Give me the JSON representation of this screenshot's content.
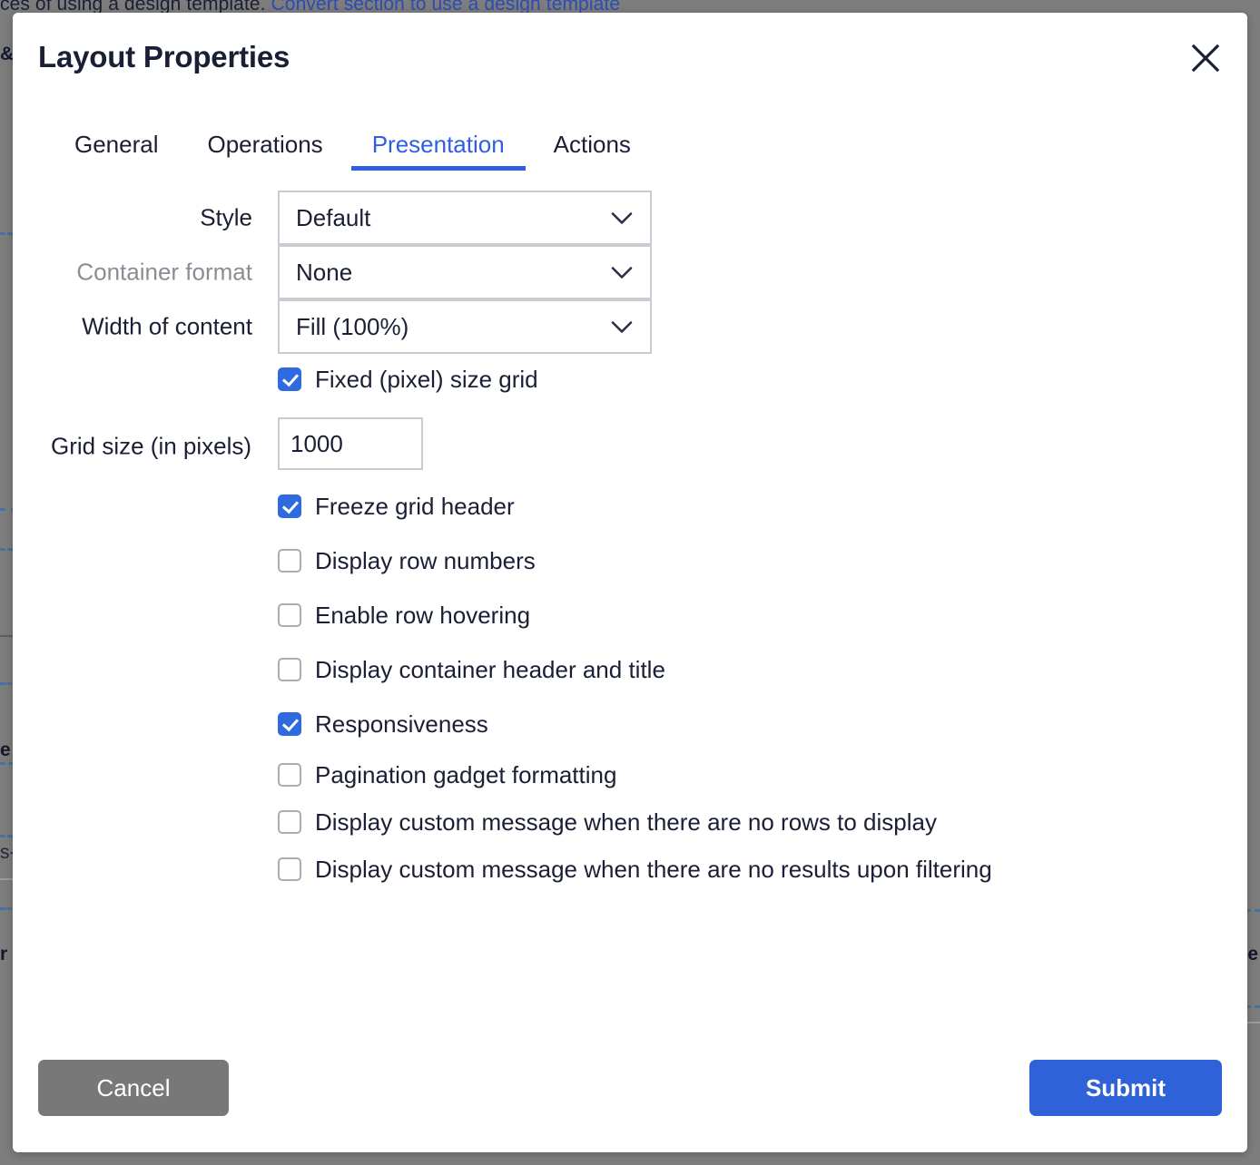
{
  "background": {
    "top_text_prefix": "ces of using a design template. ",
    "top_text_link": "Convert section to use a design template",
    "left_fragments": [
      "&",
      "e",
      "s-",
      "r"
    ],
    "right_fragments": [
      "e"
    ]
  },
  "dialog": {
    "title": "Layout Properties",
    "close_icon": "close-icon",
    "tabs": [
      {
        "label": "General",
        "active": false
      },
      {
        "label": "Operations",
        "active": false
      },
      {
        "label": "Presentation",
        "active": true
      },
      {
        "label": "Actions",
        "active": false
      }
    ],
    "fields": {
      "style": {
        "label": "Style",
        "value": "Default",
        "disabled": false
      },
      "container_format": {
        "label": "Container format",
        "value": "None",
        "disabled": true
      },
      "width_of_content": {
        "label": "Width of content",
        "value": "Fill (100%)",
        "disabled": false
      },
      "grid_size": {
        "label": "Grid size (in pixels)",
        "value": "1000",
        "placeholder": ""
      }
    },
    "checkboxes": [
      {
        "label": "Fixed (pixel) size grid",
        "checked": true
      },
      {
        "label": "Freeze grid header",
        "checked": true
      },
      {
        "label": "Display row numbers",
        "checked": false
      },
      {
        "label": "Enable row hovering",
        "checked": false
      },
      {
        "label": "Display container header and title",
        "checked": false
      },
      {
        "label": "Responsiveness",
        "checked": true
      },
      {
        "label": "Pagination gadget formatting",
        "checked": false
      },
      {
        "label": "Display custom message when there are no rows to display",
        "checked": false
      },
      {
        "label": "Display custom message when there are no results upon filtering",
        "checked": false
      }
    ],
    "footer": {
      "cancel_label": "Cancel",
      "submit_label": "Submit"
    }
  },
  "colors": {
    "accent_blue": "#2f5fe0",
    "submit_blue": "#2f62d8",
    "checkbox_blue": "#2f6ae0",
    "cancel_gray": "#787878",
    "text_dark": "#1b1f35",
    "muted_gray": "#8a8d93",
    "overlay_gray": "#7d7d7d"
  }
}
